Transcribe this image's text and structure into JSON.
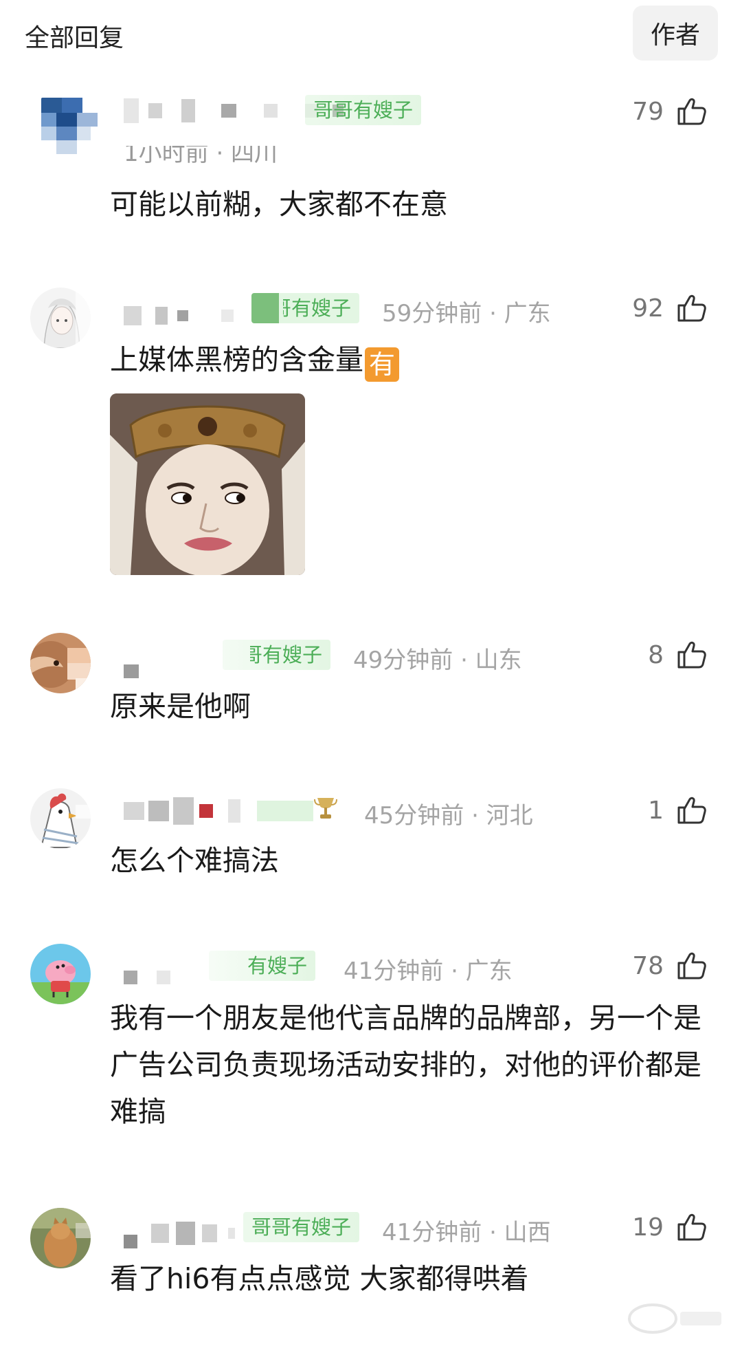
{
  "header": {
    "title": "全部回复",
    "author_button": "作者"
  },
  "comments": [
    {
      "badge": "哥哥有嫂子",
      "meta": "1小时前 · 四川",
      "likes": "79",
      "text": "可能以前糊，大家都不在意"
    },
    {
      "badge": "哥哥有嫂子",
      "meta": "59分钟前 · 广东",
      "likes": "92",
      "text": "上媒体黑榜的含金量",
      "inline_emoji": "有",
      "image": "meme-image"
    },
    {
      "badge": "哥哥有嫂子",
      "meta": "49分钟前 · 山东",
      "likes": "8",
      "text": "原来是他啊"
    },
    {
      "badge": "",
      "meta": "45分钟前 · 河北",
      "likes": "1",
      "text": "怎么个难搞法"
    },
    {
      "badge": "有嫂子",
      "meta": "41分钟前 · 广东",
      "likes": "78",
      "text": "我有一个朋友是他代言品牌的品牌部，另一个是广告公司负责现场活动安排的，对他的评价都是难搞"
    },
    {
      "badge": "哥哥有嫂子",
      "meta": "41分钟前 · 山西",
      "likes": "19",
      "text": "看了hi6有点点感觉 大家都得哄着"
    }
  ],
  "colors": {
    "badge_text": "#4cae57",
    "badge_bg": "#e3f6e3",
    "meta_text": "#a4a4a4",
    "emoji_bg": "#f39a2f"
  },
  "icons": {
    "like": "thumbs-up-icon"
  }
}
